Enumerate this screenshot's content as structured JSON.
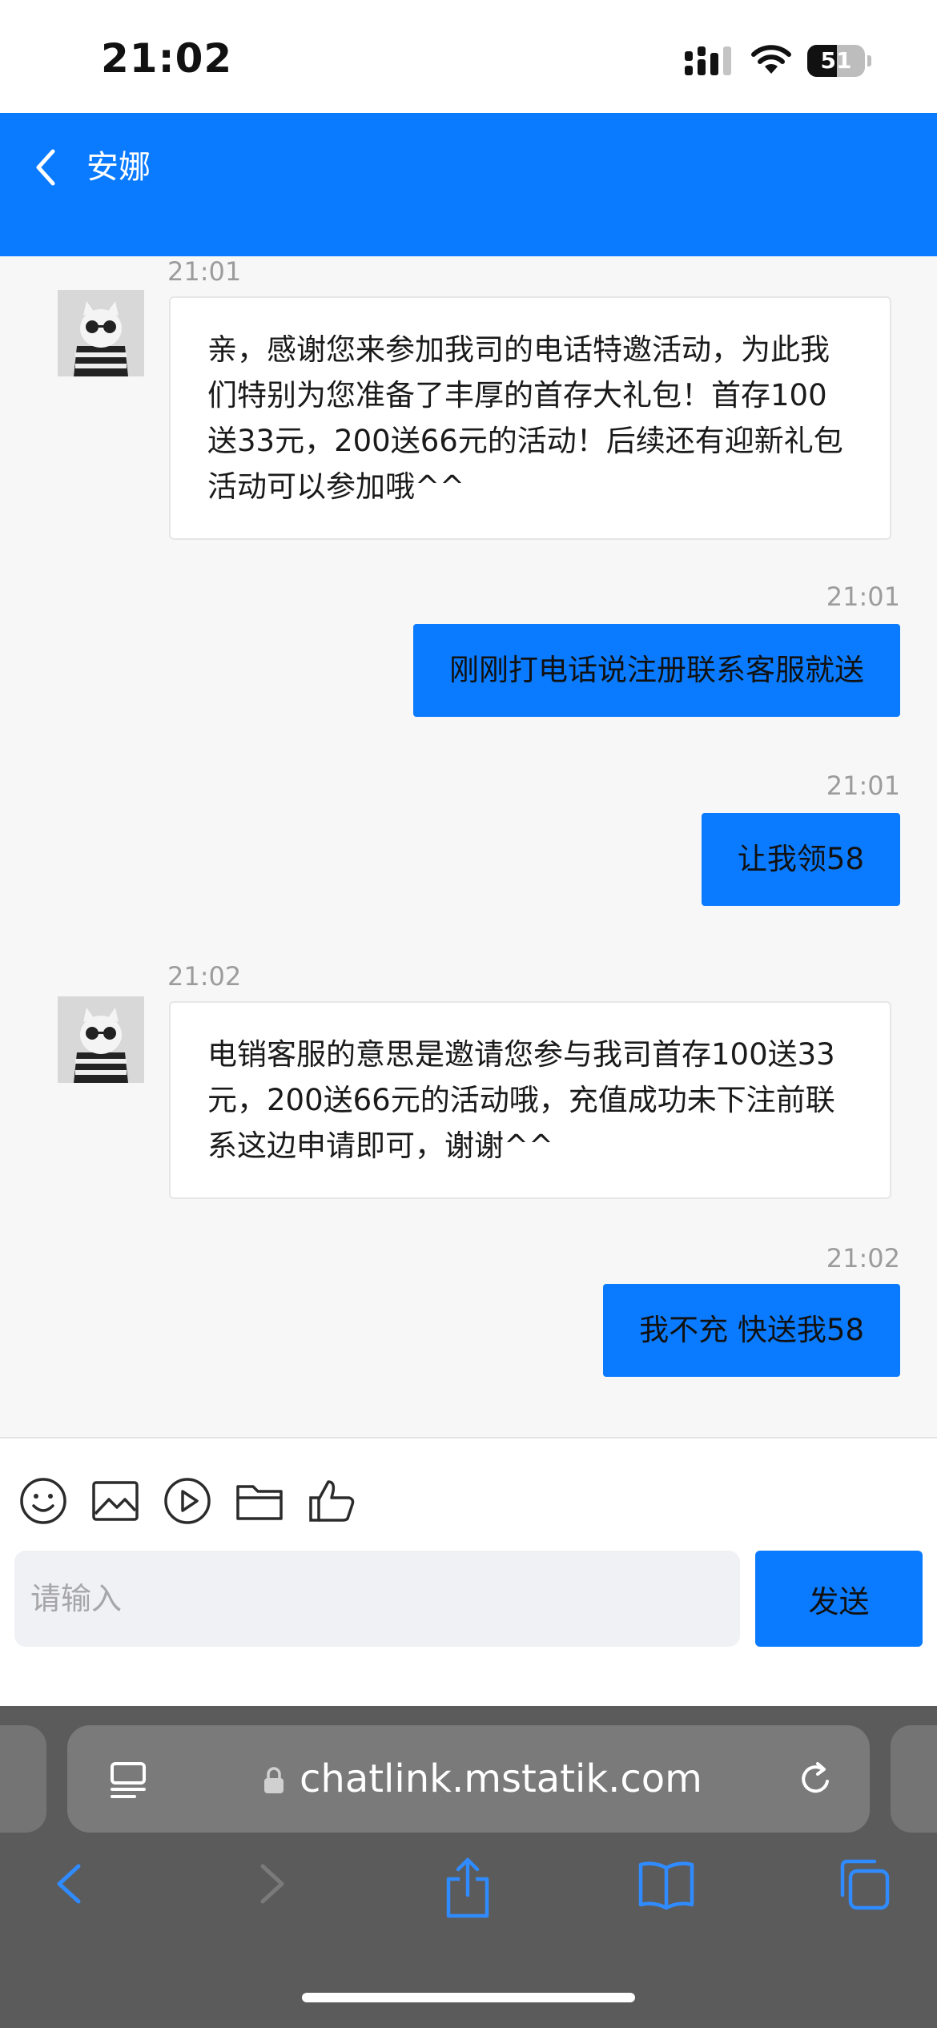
{
  "status_bar": {
    "time": "21:02",
    "battery": "51",
    "battery_level": 0.51
  },
  "header": {
    "title": "安娜",
    "back_icon": "chevron-left-icon"
  },
  "messages": [
    {
      "side": "in",
      "time": "21:01",
      "text": "亲，感谢您来参加我司的电话特邀活动，为此我们特别为您准备了丰厚的首存大礼包！首存100送33元，200送66元的活动！后续还有迎新礼包活动可以参加哦^^"
    },
    {
      "side": "out",
      "time": "21:01",
      "text": "刚刚打电话说注册联系客服就送"
    },
    {
      "side": "out",
      "time": "21:01",
      "text": "让我领58"
    },
    {
      "side": "in",
      "time": "21:02",
      "text": "电销客服的意思是邀请您参与我司首存100送33元，200送66元的活动哦，充值成功未下注前联系这边申请即可，谢谢^^"
    },
    {
      "side": "out",
      "time": "21:02",
      "text": "我不充 快送我58"
    }
  ],
  "composer": {
    "tools": [
      "emoji-icon",
      "image-icon",
      "video-icon",
      "folder-icon",
      "thumbs-up-icon"
    ],
    "placeholder": "请输入",
    "value": "",
    "send_label": "发送"
  },
  "browser": {
    "url": "chatlink.mstatik.com",
    "toolbar": [
      "back-icon",
      "forward-icon",
      "share-icon",
      "bookmarks-icon",
      "tabs-icon"
    ]
  },
  "colors": {
    "accent": "#0a7bff",
    "background": "#f7f7f8",
    "browser_chrome": "#5b5b5b"
  }
}
